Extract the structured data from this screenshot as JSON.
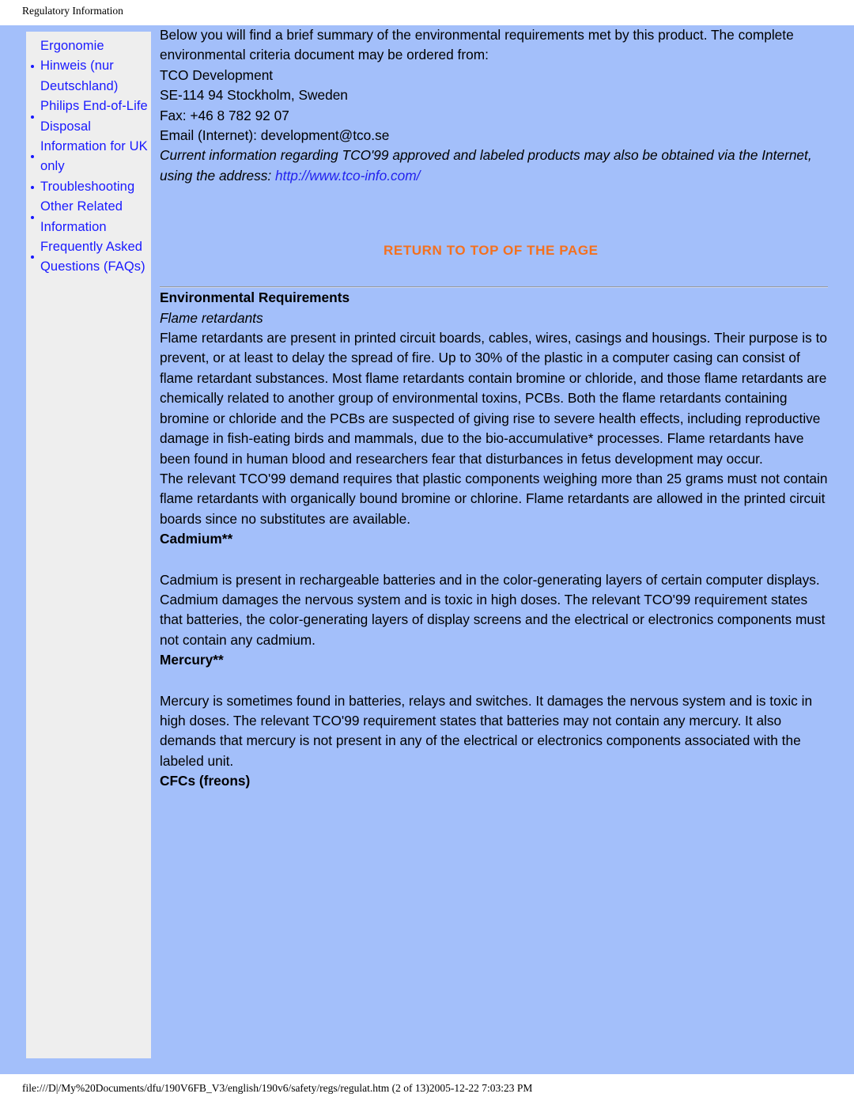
{
  "header": {
    "title": "Regulatory Information"
  },
  "sidebar": {
    "items": [
      {
        "label": "Ergonomie Hinweis (nur Deutschland)"
      },
      {
        "label": "Philips End-of-Life Disposal"
      },
      {
        "label": "Information for UK only"
      },
      {
        "label": "Troubleshooting"
      },
      {
        "label": "Other Related Information"
      },
      {
        "label": "Frequently Asked Questions (FAQs)"
      }
    ]
  },
  "main": {
    "lead_paragraph": "Below you will find a brief summary of the environmental requirements met by this product. The complete environmental criteria document may be ordered from:",
    "address": {
      "organization": "TCO Development",
      "city_line": "SE-114 94 Stockholm, Sweden",
      "fax": "Fax: +46 8 782 92 07",
      "email": "Email (Internet): development@tco.se"
    },
    "italic_note_text": "Current information regarding TCO'99 approved and labeled products may also be obtained via the Internet, using the address: ",
    "italic_note_link": "http://www.tco-info.com/",
    "return_to_top": "RETURN TO TOP OF THE PAGE",
    "section_title": "Environmental Requirements",
    "flame_retardants": {
      "subtitle": "Flame retardants",
      "paragraph_1": "Flame retardants are present in printed circuit boards, cables, wires, casings and housings. Their purpose is to prevent, or at least to delay the spread of fire. Up to 30% of the plastic in a computer casing can consist of flame retardant substances. Most flame retardants contain bromine or chloride, and those flame retardants are chemically related to another group of environmental toxins, PCBs. Both the flame retardants containing bromine or chloride and the PCBs are suspected of giving rise to severe health effects, including reproductive damage in fish-eating birds and mammals, due to the bio-accumulative* processes. Flame retardants have been found in human blood and researchers fear that disturbances in fetus development may occur.",
      "paragraph_2": "The relevant TCO'99 demand requires that plastic components weighing more than 25 grams must not contain flame retardants with organically bound bromine or chlorine. Flame retardants are allowed in the printed circuit boards since no substitutes are available."
    },
    "cadmium": {
      "heading": "Cadmium**",
      "paragraph": "Cadmium is present in rechargeable batteries and in the color-generating layers of certain computer displays. Cadmium damages the nervous system and is toxic in high doses. The relevant TCO'99 requirement states that batteries, the color-generating layers of display screens and the electrical or electronics components must not contain any cadmium."
    },
    "mercury": {
      "heading": "Mercury**",
      "paragraph": "Mercury is sometimes found in batteries, relays and switches. It damages the nervous system and is toxic in high doses. The relevant TCO'99 requirement states that batteries may not contain any mercury. It also demands that mercury is not present in any of the electrical or electronics components associated with the labeled unit."
    },
    "cfcs": {
      "heading": "CFCs (freons)"
    }
  },
  "footer": {
    "path_info": "file:///D|/My%20Documents/dfu/190V6FB_V3/english/190v6/safety/regs/regulat.htm (2 of 13)2005-12-22 7:03:23 PM"
  },
  "colors": {
    "page_background": "#a3bffa",
    "sidebar_background": "#eeeeee",
    "link_blue": "#1919ff",
    "accent_orange": "#f4701e",
    "heading_blue": "#1b3fe0"
  }
}
